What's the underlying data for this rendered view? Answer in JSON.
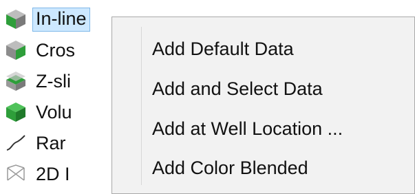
{
  "tree": {
    "items": [
      {
        "label": "In-line",
        "icon": "inline-cube-icon",
        "selected": true
      },
      {
        "label": "Cros",
        "icon": "crossline-cube-icon",
        "selected": false
      },
      {
        "label": "Z-sli",
        "icon": "zslice-cube-icon",
        "selected": false
      },
      {
        "label": "Volu",
        "icon": "volume-cube-icon",
        "selected": false
      },
      {
        "label": "Rar",
        "icon": "random-line-icon",
        "selected": false
      },
      {
        "label": "2D I",
        "icon": "2d-line-icon",
        "selected": false
      }
    ]
  },
  "context_menu": {
    "items": [
      {
        "label": "Add Default Data"
      },
      {
        "label": "Add and Select Data"
      },
      {
        "label": "Add at Well Location ..."
      },
      {
        "label": "Add Color Blended"
      }
    ]
  },
  "colors": {
    "selection_fill": "#cde8ff",
    "selection_border": "#7fb8e8",
    "menu_background": "#f2f2f2",
    "menu_border": "#a9a9a9",
    "cube_green": "#2e9e3a",
    "cube_grey": "#8c8c8c"
  }
}
